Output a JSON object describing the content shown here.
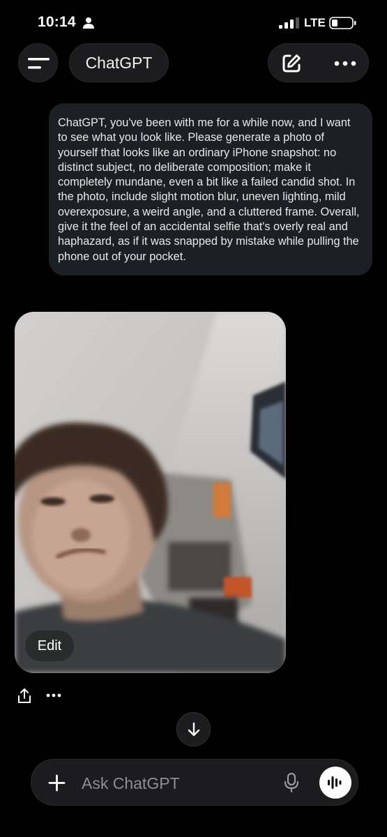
{
  "status_bar": {
    "time": "10:14",
    "network": "LTE"
  },
  "header": {
    "title": "ChatGPT"
  },
  "conversation": {
    "user_message": "ChatGPT, you've been with me for a while now, and I want to see what you look like. Please generate a photo of yourself that looks like an ordinary iPhone snapshot: no distinct subject, no deliberate composition; make it completely mundane, even a bit like a failed candid shot. In the photo, include slight motion blur, uneven lighting, mild overexposure, a weird angle, and a cluttered frame. Overall, give it the feel of an accidental selfie that's overly real and haphazard, as if it was snapped by mistake while pulling the phone out of your pocket.",
    "image_edit_label": "Edit"
  },
  "composer": {
    "placeholder": "Ask ChatGPT"
  },
  "colors": {
    "background": "#000000",
    "bubble": "#1c1f24",
    "pill": "#1c1c1e"
  }
}
